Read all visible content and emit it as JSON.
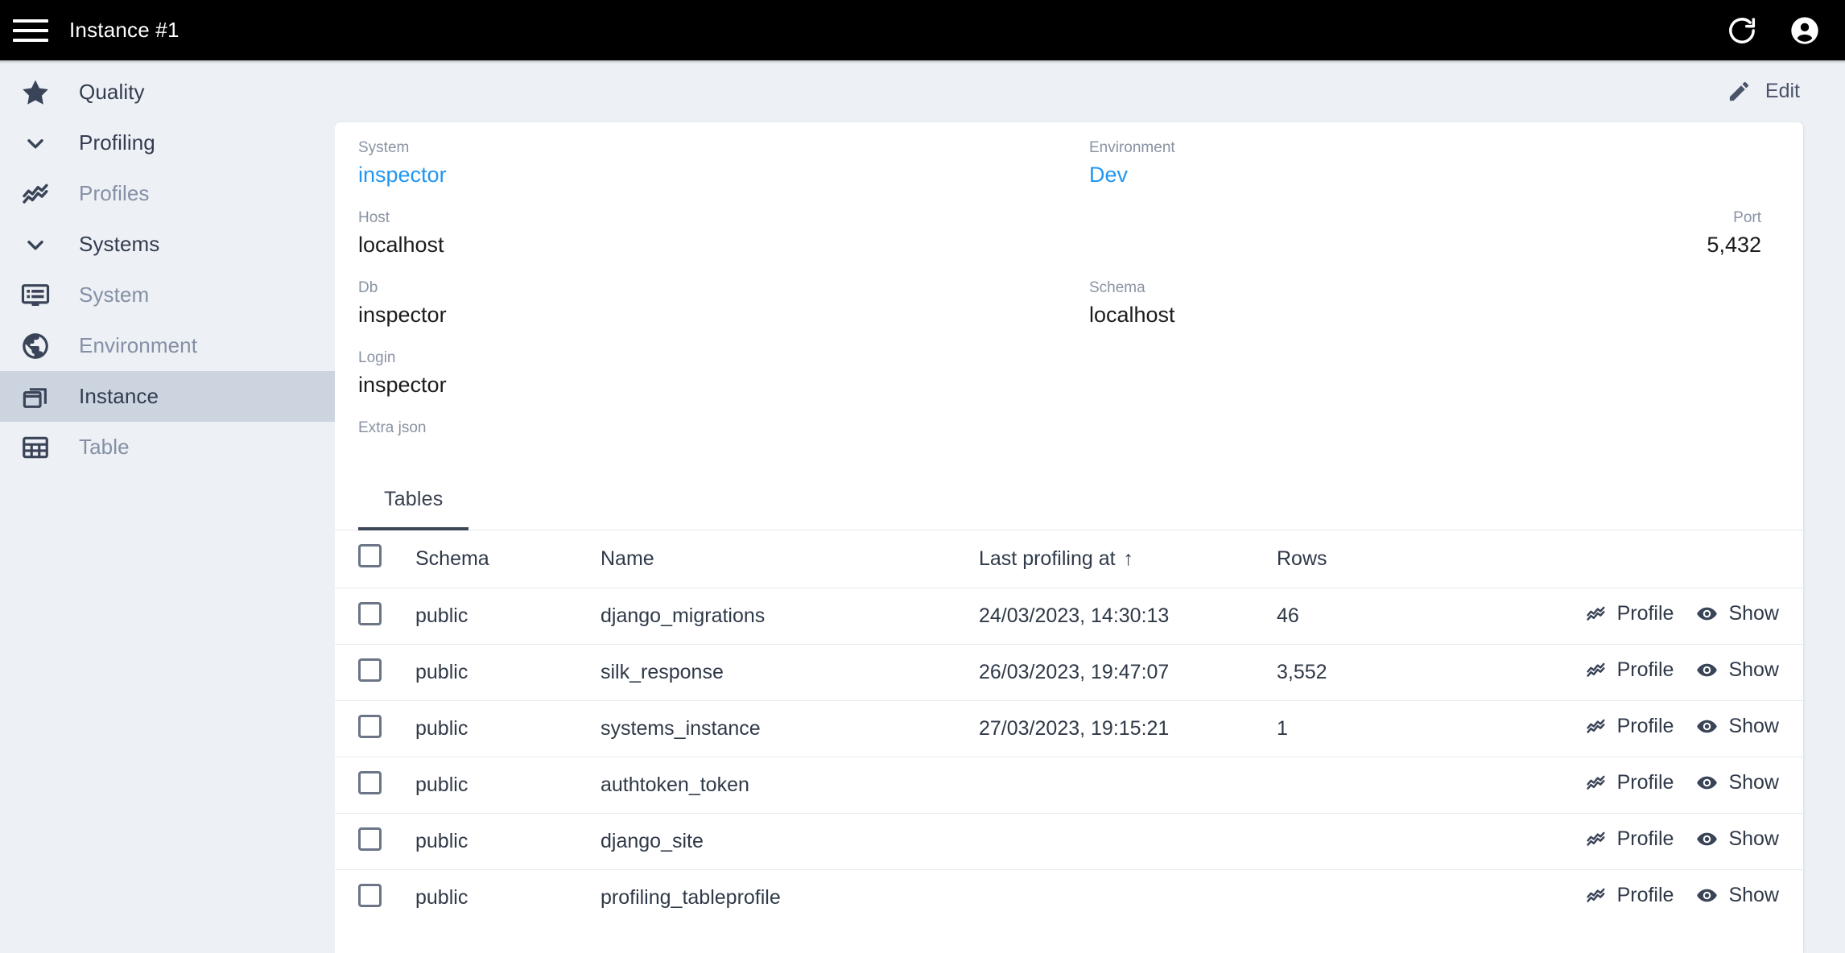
{
  "topbar": {
    "title": "Instance #1",
    "menu_icon": "hamburger-menu-icon",
    "refresh_icon": "refresh-icon",
    "account_icon": "account-circle-icon"
  },
  "sidebar": {
    "items": [
      {
        "label": "Quality",
        "icon": "star-icon",
        "level": "top",
        "selected": false,
        "muted": false
      },
      {
        "label": "Profiling",
        "icon": "chevron-down-icon",
        "level": "group",
        "selected": false,
        "muted": false
      },
      {
        "label": "Profiles",
        "icon": "trending-icon",
        "level": "child",
        "selected": false,
        "muted": true
      },
      {
        "label": "Systems",
        "icon": "chevron-down-icon",
        "level": "group",
        "selected": false,
        "muted": false
      },
      {
        "label": "System",
        "icon": "monitor-icon",
        "level": "child",
        "selected": false,
        "muted": true
      },
      {
        "label": "Environment",
        "icon": "globe-icon",
        "level": "child",
        "selected": false,
        "muted": true
      },
      {
        "label": "Instance",
        "icon": "windows-icon",
        "level": "child",
        "selected": true,
        "muted": false
      },
      {
        "label": "Table",
        "icon": "grid-table-icon",
        "level": "child",
        "selected": false,
        "muted": true
      }
    ]
  },
  "toolbar": {
    "edit_label": "Edit",
    "edit_icon": "pencil-icon"
  },
  "details": {
    "system_label": "System",
    "system_value": "inspector",
    "environment_label": "Environment",
    "environment_value": "Dev",
    "host_label": "Host",
    "host_value": "localhost",
    "port_label": "Port",
    "port_value": "5,432",
    "db_label": "Db",
    "db_value": "inspector",
    "schema_label": "Schema",
    "schema_value": "localhost",
    "login_label": "Login",
    "login_value": "inspector",
    "extra_json_label": "Extra json",
    "extra_json_value": ""
  },
  "tabs": [
    {
      "label": "Tables",
      "active": true
    }
  ],
  "table": {
    "select_all_checked": false,
    "columns": {
      "schema": "Schema",
      "name": "Name",
      "last_profiling_at": "Last profiling at",
      "sort_indicator": "↑",
      "rows": "Rows"
    },
    "actions": {
      "profile_label": "Profile",
      "profile_icon": "trending-icon",
      "show_label": "Show",
      "show_icon": "eye-icon"
    },
    "rows": [
      {
        "checked": false,
        "schema": "public",
        "name": "django_migrations",
        "last_profiling_at": "24/03/2023, 14:30:13",
        "rows": "46"
      },
      {
        "checked": false,
        "schema": "public",
        "name": "silk_response",
        "last_profiling_at": "26/03/2023, 19:47:07",
        "rows": "3,552"
      },
      {
        "checked": false,
        "schema": "public",
        "name": "systems_instance",
        "last_profiling_at": "27/03/2023, 19:15:21",
        "rows": "1"
      },
      {
        "checked": false,
        "schema": "public",
        "name": "authtoken_token",
        "last_profiling_at": "",
        "rows": ""
      },
      {
        "checked": false,
        "schema": "public",
        "name": "django_site",
        "last_profiling_at": "",
        "rows": ""
      },
      {
        "checked": false,
        "schema": "public",
        "name": "profiling_tableprofile",
        "last_profiling_at": "",
        "rows": ""
      }
    ]
  },
  "colors": {
    "topbar_bg": "#000000",
    "page_bg": "#edf0f5",
    "card_bg": "#ffffff",
    "link": "#2196f3",
    "selected_nav_bg": "#ccd4e0",
    "text_dark": "#2f3948",
    "text_muted": "#8a93a3"
  }
}
